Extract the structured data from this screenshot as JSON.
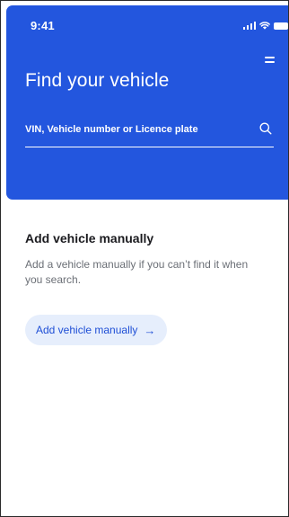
{
  "status_bar": {
    "time": "9:41"
  },
  "header": {
    "title": "Find your vehicle",
    "background_color": "#2356de"
  },
  "search": {
    "placeholder": "VIN, Vehicle number or Licence plate",
    "value": ""
  },
  "manual_section": {
    "title": "Add vehicle manually",
    "description": "Add a vehicle manually if you can’t find it when you search.",
    "button_label": "Add vehicle manually",
    "button_arrow": "→",
    "button_bg": "#e6eefc",
    "button_text_color": "#1f4fd6"
  },
  "icons": {
    "menu": "menu-icon",
    "search": "search-icon",
    "signal": "signal-icon",
    "wifi": "wifi-icon",
    "battery": "battery-icon",
    "arrow": "arrow-right-icon"
  }
}
